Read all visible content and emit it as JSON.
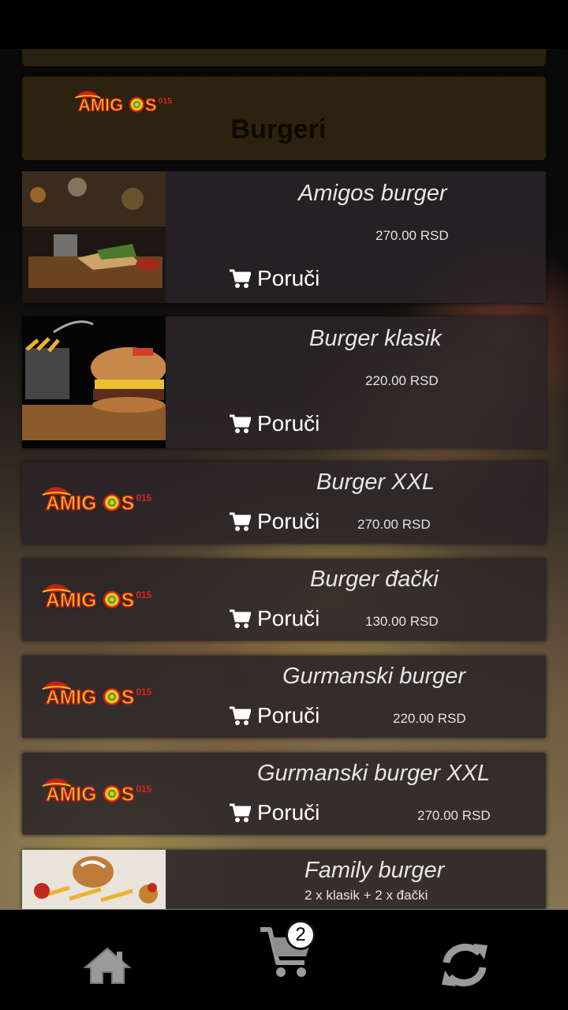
{
  "category": {
    "title": "Burgeri"
  },
  "brand": {
    "logo_text": "AMIGOS",
    "logo_suffix": "015"
  },
  "order_label": "Poruči",
  "products": [
    {
      "name": "Amigos burger",
      "price": "270.00 RSD"
    },
    {
      "name": "Burger klasik",
      "price": "220.00 RSD"
    },
    {
      "name": "Burger XXL",
      "price": "270.00 RSD"
    },
    {
      "name": "Burger đački",
      "price": "130.00 RSD"
    },
    {
      "name": "Gurmanski burger",
      "price": "220.00 RSD"
    },
    {
      "name": "Gurmanski burger XXL",
      "price": "270.00 RSD"
    },
    {
      "name": "Family burger",
      "description": "2 x klasik + 2 x đački"
    }
  ],
  "nav": {
    "home_icon": "home-icon",
    "cart_icon": "cart-icon",
    "cart_count": "2",
    "refresh_icon": "refresh-icon"
  },
  "colors": {
    "header_bg": "#2c220f",
    "card_bg": "#2a2428",
    "logo_red": "#d8261c",
    "logo_yellow": "#f3c21a"
  }
}
